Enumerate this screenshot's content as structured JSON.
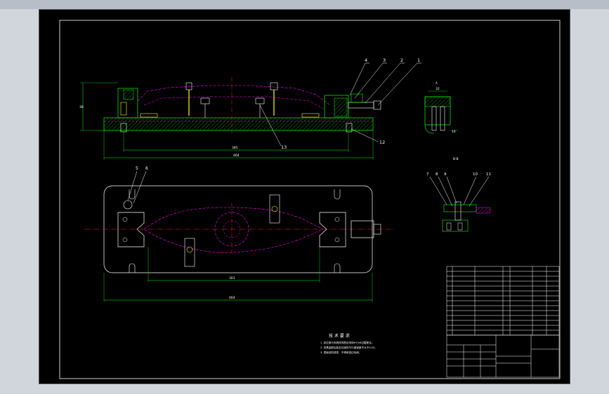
{
  "balloons": {
    "b1": "1",
    "b2": "2",
    "b3": "3",
    "b4": "4",
    "b5": "5",
    "b6": "6",
    "b7": "7",
    "b8": "8",
    "b9": "9",
    "b10": "10",
    "b11": "11",
    "b12": "12",
    "b13": "13"
  },
  "dimensions": {
    "front_height": "38",
    "front_inner": "385",
    "front_overall": "464",
    "top_inner": "301",
    "top_overall": "464",
    "section_width": "32",
    "section_height": "14",
    "detail_dim": "14"
  },
  "view_labels": {
    "section_a": "A",
    "section_b": "B-B"
  },
  "tech_requirements": {
    "title": "技 术 要 求",
    "lines": [
      "1. 定位销与夹具体的配合采用H7/n6过盈配合。",
      "2. 夹具装配后各定位面的平行度误差不大于0.02。",
      "3. 表面涂防锈漆，不得有锐边毛刺。"
    ]
  },
  "colors": {
    "outline": "#ffffff",
    "part": "#00ff00",
    "hidden": "#ff00ff",
    "center": "#ff2020",
    "dim": "#00ff00",
    "leader": "#ffffff",
    "bolt": "#ffff00",
    "hatch": "#00cc00",
    "frame_bg": "#000000",
    "page_bg": "#d1d5dc"
  }
}
